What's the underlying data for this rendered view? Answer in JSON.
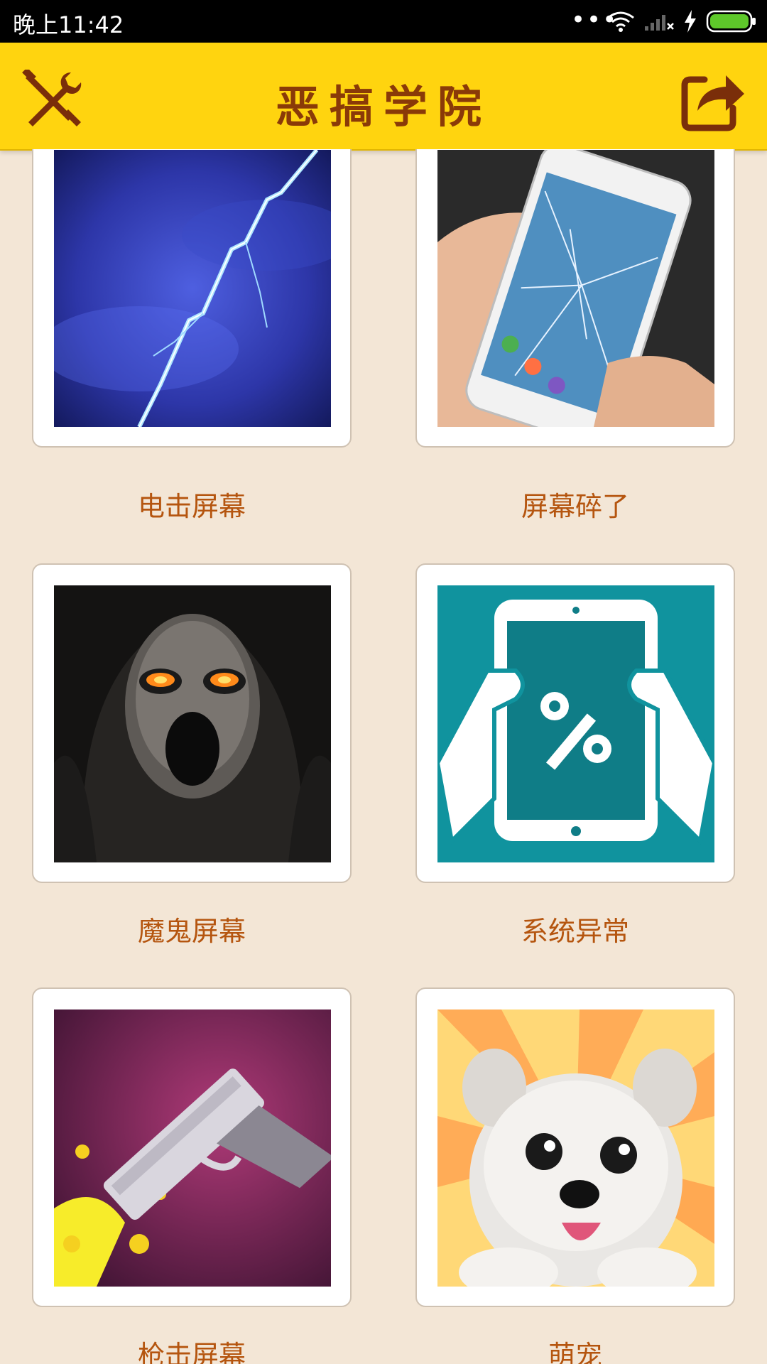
{
  "status_bar": {
    "time": "晚上11:42",
    "icons": [
      "more-dots-icon",
      "wifi-icon",
      "signal-icon",
      "charging-bolt-icon",
      "battery-icon"
    ]
  },
  "header": {
    "title": "恶搞学院",
    "left_icon": "tools-icon",
    "right_icon": "share-icon",
    "background_color": "#ffd40f",
    "title_color": "#8a3a08"
  },
  "items": [
    {
      "label": "电击屏幕",
      "icon": "lightning-thumbnail"
    },
    {
      "label": "屏幕碎了",
      "icon": "cracked-phone-thumbnail"
    },
    {
      "label": "魔鬼屏幕",
      "icon": "ghost-face-thumbnail"
    },
    {
      "label": "系统异常",
      "icon": "system-error-thumbnail"
    },
    {
      "label": "枪击屏幕",
      "icon": "pistol-thumbnail"
    },
    {
      "label": "萌宠",
      "icon": "puppy-thumbnail"
    }
  ],
  "colors": {
    "page_background": "#f3e6d6",
    "label_text": "#b5550f"
  }
}
